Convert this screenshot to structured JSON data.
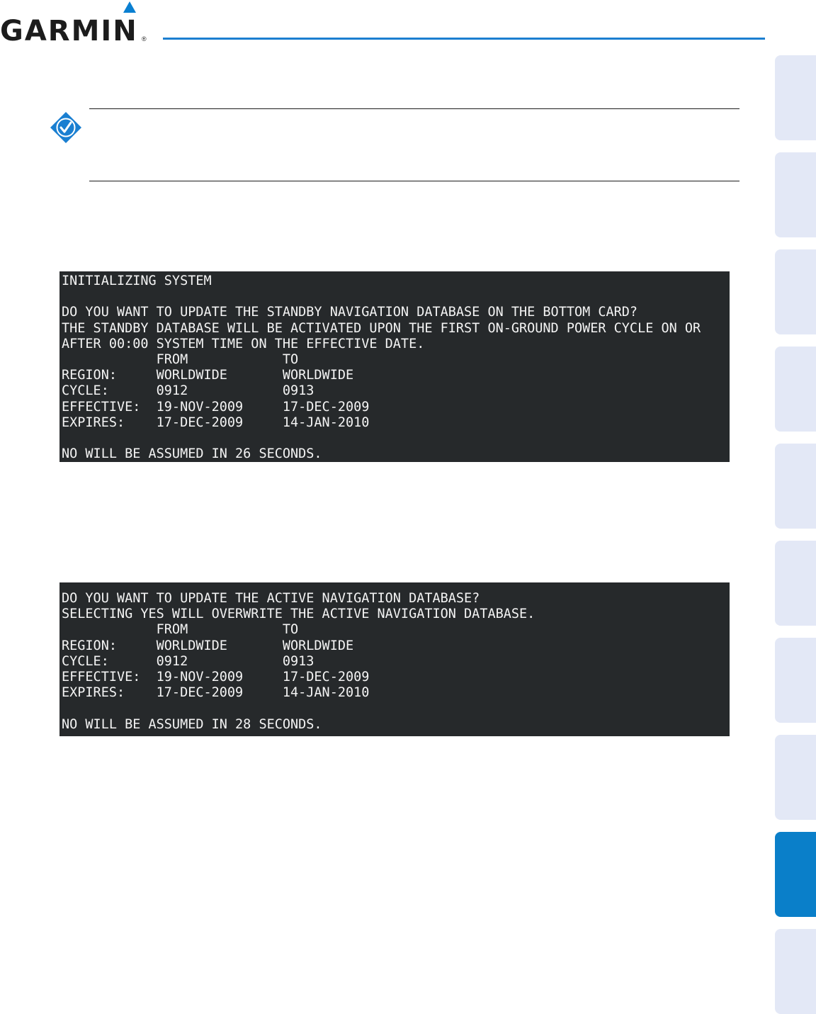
{
  "header": {
    "brand": "GARMIN",
    "registered_mark": "®",
    "accent_color": "#1c7fd0"
  },
  "side_tabs": {
    "count": 10,
    "active_index": 8,
    "active_color": "#0a7fc9",
    "inactive_color": "#e3e8f6"
  },
  "note": {
    "icon": "checkmark-note-icon"
  },
  "screens": [
    {
      "lines": [
        "INITIALIZING SYSTEM",
        "",
        "DO YOU WANT TO UPDATE THE STANDBY NAVIGATION DATABASE ON THE BOTTOM CARD?",
        "THE STANDBY DATABASE WILL BE ACTIVATED UPON THE FIRST ON-GROUND POWER CYCLE ON OR",
        "AFTER 00:00 SYSTEM TIME ON THE EFFECTIVE DATE.",
        "            FROM            TO",
        "REGION:     WORLDWIDE       WORLDWIDE",
        "CYCLE:      0912            0913",
        "EFFECTIVE:  19-NOV-2009     17-DEC-2009",
        "EXPIRES:    17-DEC-2009     14-JAN-2010",
        "",
        "NO WILL BE ASSUMED IN 26 SECONDS."
      ]
    },
    {
      "lines": [
        "DO YOU WANT TO UPDATE THE ACTIVE NAVIGATION DATABASE?",
        "SELECTING YES WILL OVERWRITE THE ACTIVE NAVIGATION DATABASE.",
        "            FROM            TO",
        "REGION:     WORLDWIDE       WORLDWIDE",
        "CYCLE:      0912            0913",
        "EFFECTIVE:  19-NOV-2009     17-DEC-2009",
        "EXPIRES:    17-DEC-2009     14-JAN-2010",
        "",
        "NO WILL BE ASSUMED IN 28 SECONDS."
      ]
    }
  ]
}
